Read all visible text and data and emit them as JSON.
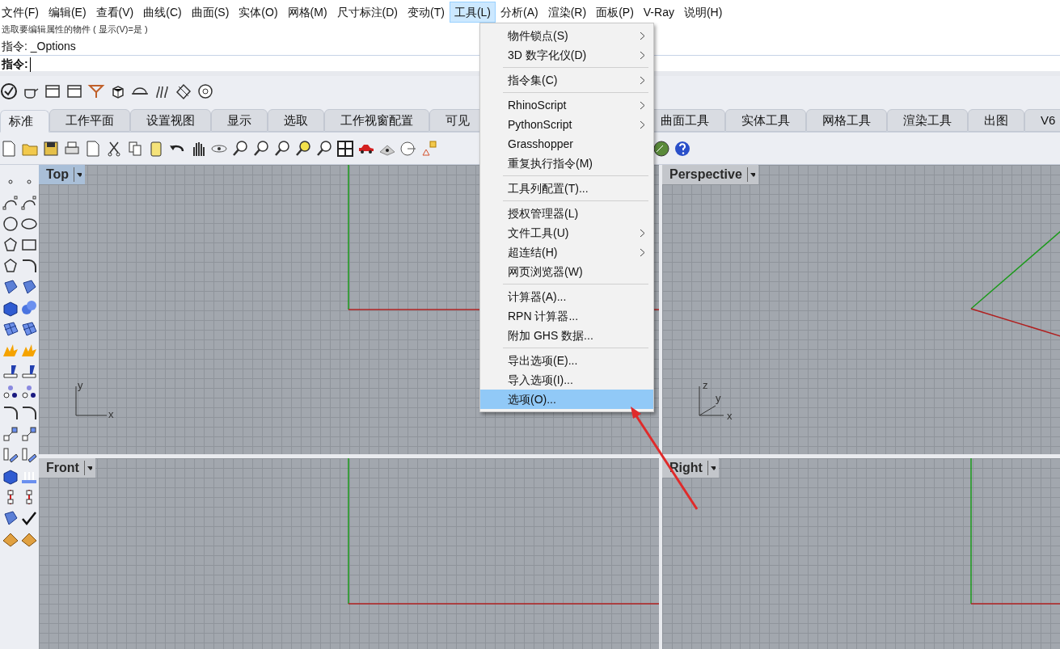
{
  "menu_bar": [
    {
      "label": "文件(F)",
      "selected": false
    },
    {
      "label": "编辑(E)",
      "selected": false
    },
    {
      "label": "查看(V)",
      "selected": false
    },
    {
      "label": "曲线(C)",
      "selected": false
    },
    {
      "label": "曲面(S)",
      "selected": false
    },
    {
      "label": "实体(O)",
      "selected": false
    },
    {
      "label": "网格(M)",
      "selected": false
    },
    {
      "label": "尺寸标注(D)",
      "selected": false
    },
    {
      "label": "变动(T)",
      "selected": false
    },
    {
      "label": "工具(L)",
      "selected": true
    },
    {
      "label": "分析(A)",
      "selected": false
    },
    {
      "label": "渲染(R)",
      "selected": false
    },
    {
      "label": "面板(P)",
      "selected": false
    },
    {
      "label": "V-Ray",
      "selected": false
    },
    {
      "label": "说明(H)",
      "selected": false
    }
  ],
  "command_area": {
    "history": [
      "选取要编辑属性的物件 ( 显示(V)=是 )",
      "指令: _Options"
    ],
    "prompt": "指令:"
  },
  "tabs": [
    {
      "label": "标准",
      "selected": true
    },
    {
      "label": "工作平面",
      "selected": false
    },
    {
      "label": "设置视图",
      "selected": false
    },
    {
      "label": "显示",
      "selected": false
    },
    {
      "label": "选取",
      "selected": false
    },
    {
      "label": "工作视窗配置",
      "selected": false
    },
    {
      "label": "可见",
      "selected": false
    },
    {
      "label": "曲面工具",
      "selected": false
    },
    {
      "label": "实体工具",
      "selected": false
    },
    {
      "label": "网格工具",
      "selected": false
    },
    {
      "label": "渲染工具",
      "selected": false
    },
    {
      "label": "出图",
      "selected": false
    },
    {
      "label": "V6",
      "selected": false
    }
  ],
  "tools_menu": {
    "groups": [
      [
        {
          "label": "物件锁点(S)",
          "submenu": true,
          "selected": false
        },
        {
          "label": "3D 数字化仪(D)",
          "submenu": true,
          "selected": false
        }
      ],
      [
        {
          "label": "指令集(C)",
          "submenu": true,
          "selected": false
        }
      ],
      [
        {
          "label": "RhinoScript",
          "submenu": true,
          "selected": false
        },
        {
          "label": "PythonScript",
          "submenu": true,
          "selected": false
        },
        {
          "label": "Grasshopper",
          "submenu": false,
          "selected": false
        },
        {
          "label": "重复执行指令(M)",
          "submenu": false,
          "selected": false
        }
      ],
      [
        {
          "label": "工具列配置(T)...",
          "submenu": false,
          "selected": false
        }
      ],
      [
        {
          "label": "授权管理器(L)",
          "submenu": false,
          "selected": false
        },
        {
          "label": "文件工具(U)",
          "submenu": true,
          "selected": false
        },
        {
          "label": "超连结(H)",
          "submenu": true,
          "selected": false
        },
        {
          "label": "网页浏览器(W)",
          "submenu": false,
          "selected": false
        }
      ],
      [
        {
          "label": "计算器(A)...",
          "submenu": false,
          "selected": false
        },
        {
          "label": "RPN 计算器...",
          "submenu": false,
          "selected": false
        },
        {
          "label": "附加 GHS 数据...",
          "submenu": false,
          "selected": false
        }
      ],
      [
        {
          "label": "导出选项(E)...",
          "submenu": false,
          "selected": false
        },
        {
          "label": "导入选项(I)...",
          "submenu": false,
          "selected": false
        },
        {
          "label": "选项(O)...",
          "submenu": false,
          "selected": true
        }
      ]
    ]
  },
  "viewports": [
    {
      "kind": "top",
      "title": "Top",
      "selected": true,
      "axes": [
        "y",
        "x"
      ]
    },
    {
      "kind": "perspective",
      "title": "Perspective",
      "selected": false,
      "axes": [
        "z",
        "y",
        "x"
      ]
    },
    {
      "kind": "front",
      "title": "Front",
      "selected": false
    },
    {
      "kind": "right",
      "title": "Right",
      "selected": false
    }
  ]
}
